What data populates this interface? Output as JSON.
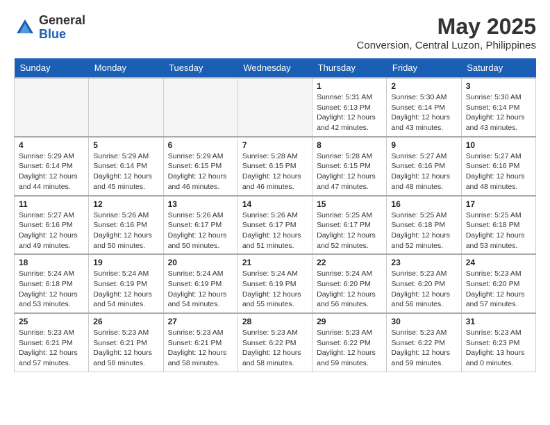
{
  "logo": {
    "general": "General",
    "blue": "Blue"
  },
  "title": "May 2025",
  "location": "Conversion, Central Luzon, Philippines",
  "days_of_week": [
    "Sunday",
    "Monday",
    "Tuesday",
    "Wednesday",
    "Thursday",
    "Friday",
    "Saturday"
  ],
  "weeks": [
    [
      {
        "day": "",
        "empty": true
      },
      {
        "day": "",
        "empty": true
      },
      {
        "day": "",
        "empty": true
      },
      {
        "day": "",
        "empty": true
      },
      {
        "day": "1",
        "sunrise": "5:31 AM",
        "sunset": "6:13 PM",
        "daylight": "12 hours and 42 minutes."
      },
      {
        "day": "2",
        "sunrise": "5:30 AM",
        "sunset": "6:14 PM",
        "daylight": "12 hours and 43 minutes."
      },
      {
        "day": "3",
        "sunrise": "5:30 AM",
        "sunset": "6:14 PM",
        "daylight": "12 hours and 43 minutes."
      }
    ],
    [
      {
        "day": "4",
        "sunrise": "5:29 AM",
        "sunset": "6:14 PM",
        "daylight": "12 hours and 44 minutes."
      },
      {
        "day": "5",
        "sunrise": "5:29 AM",
        "sunset": "6:14 PM",
        "daylight": "12 hours and 45 minutes."
      },
      {
        "day": "6",
        "sunrise": "5:29 AM",
        "sunset": "6:15 PM",
        "daylight": "12 hours and 46 minutes."
      },
      {
        "day": "7",
        "sunrise": "5:28 AM",
        "sunset": "6:15 PM",
        "daylight": "12 hours and 46 minutes."
      },
      {
        "day": "8",
        "sunrise": "5:28 AM",
        "sunset": "6:15 PM",
        "daylight": "12 hours and 47 minutes."
      },
      {
        "day": "9",
        "sunrise": "5:27 AM",
        "sunset": "6:16 PM",
        "daylight": "12 hours and 48 minutes."
      },
      {
        "day": "10",
        "sunrise": "5:27 AM",
        "sunset": "6:16 PM",
        "daylight": "12 hours and 48 minutes."
      }
    ],
    [
      {
        "day": "11",
        "sunrise": "5:27 AM",
        "sunset": "6:16 PM",
        "daylight": "12 hours and 49 minutes."
      },
      {
        "day": "12",
        "sunrise": "5:26 AM",
        "sunset": "6:16 PM",
        "daylight": "12 hours and 50 minutes."
      },
      {
        "day": "13",
        "sunrise": "5:26 AM",
        "sunset": "6:17 PM",
        "daylight": "12 hours and 50 minutes."
      },
      {
        "day": "14",
        "sunrise": "5:26 AM",
        "sunset": "6:17 PM",
        "daylight": "12 hours and 51 minutes."
      },
      {
        "day": "15",
        "sunrise": "5:25 AM",
        "sunset": "6:17 PM",
        "daylight": "12 hours and 52 minutes."
      },
      {
        "day": "16",
        "sunrise": "5:25 AM",
        "sunset": "6:18 PM",
        "daylight": "12 hours and 52 minutes."
      },
      {
        "day": "17",
        "sunrise": "5:25 AM",
        "sunset": "6:18 PM",
        "daylight": "12 hours and 53 minutes."
      }
    ],
    [
      {
        "day": "18",
        "sunrise": "5:24 AM",
        "sunset": "6:18 PM",
        "daylight": "12 hours and 53 minutes."
      },
      {
        "day": "19",
        "sunrise": "5:24 AM",
        "sunset": "6:19 PM",
        "daylight": "12 hours and 54 minutes."
      },
      {
        "day": "20",
        "sunrise": "5:24 AM",
        "sunset": "6:19 PM",
        "daylight": "12 hours and 54 minutes."
      },
      {
        "day": "21",
        "sunrise": "5:24 AM",
        "sunset": "6:19 PM",
        "daylight": "12 hours and 55 minutes."
      },
      {
        "day": "22",
        "sunrise": "5:24 AM",
        "sunset": "6:20 PM",
        "daylight": "12 hours and 56 minutes."
      },
      {
        "day": "23",
        "sunrise": "5:23 AM",
        "sunset": "6:20 PM",
        "daylight": "12 hours and 56 minutes."
      },
      {
        "day": "24",
        "sunrise": "5:23 AM",
        "sunset": "6:20 PM",
        "daylight": "12 hours and 57 minutes."
      }
    ],
    [
      {
        "day": "25",
        "sunrise": "5:23 AM",
        "sunset": "6:21 PM",
        "daylight": "12 hours and 57 minutes."
      },
      {
        "day": "26",
        "sunrise": "5:23 AM",
        "sunset": "6:21 PM",
        "daylight": "12 hours and 58 minutes."
      },
      {
        "day": "27",
        "sunrise": "5:23 AM",
        "sunset": "6:21 PM",
        "daylight": "12 hours and 58 minutes."
      },
      {
        "day": "28",
        "sunrise": "5:23 AM",
        "sunset": "6:22 PM",
        "daylight": "12 hours and 58 minutes."
      },
      {
        "day": "29",
        "sunrise": "5:23 AM",
        "sunset": "6:22 PM",
        "daylight": "12 hours and 59 minutes."
      },
      {
        "day": "30",
        "sunrise": "5:23 AM",
        "sunset": "6:22 PM",
        "daylight": "12 hours and 59 minutes."
      },
      {
        "day": "31",
        "sunrise": "5:23 AM",
        "sunset": "6:23 PM",
        "daylight": "13 hours and 0 minutes."
      }
    ]
  ]
}
